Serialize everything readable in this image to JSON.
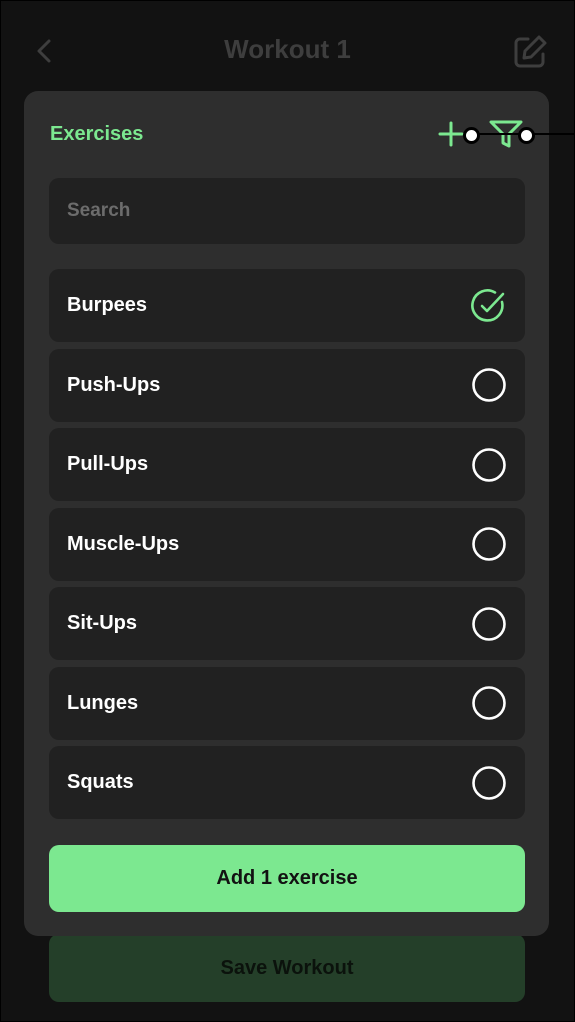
{
  "page": {
    "title": "Workout 1",
    "save_label": "Save Workout"
  },
  "modal": {
    "title": "Exercises",
    "search_placeholder": "Search",
    "add_button_label": "Add 1 exercise",
    "exercises": [
      {
        "label": "Burpees",
        "selected": true
      },
      {
        "label": "Push-Ups",
        "selected": false
      },
      {
        "label": "Pull-Ups",
        "selected": false
      },
      {
        "label": "Muscle-Ups",
        "selected": false
      },
      {
        "label": "Sit-Ups",
        "selected": false
      },
      {
        "label": "Lunges",
        "selected": false
      },
      {
        "label": "Squats",
        "selected": false
      }
    ]
  },
  "icons": {
    "back": "chevron-left-icon",
    "edit": "edit-icon",
    "add": "plus-icon",
    "filter": "filter-icon",
    "checked": "check-circle-icon",
    "unchecked": "circle-icon"
  },
  "colors": {
    "accent": "#7ce890",
    "background": "#121212",
    "panel": "#2e2e2e",
    "row": "#212121",
    "muted_button": "#243f29"
  }
}
